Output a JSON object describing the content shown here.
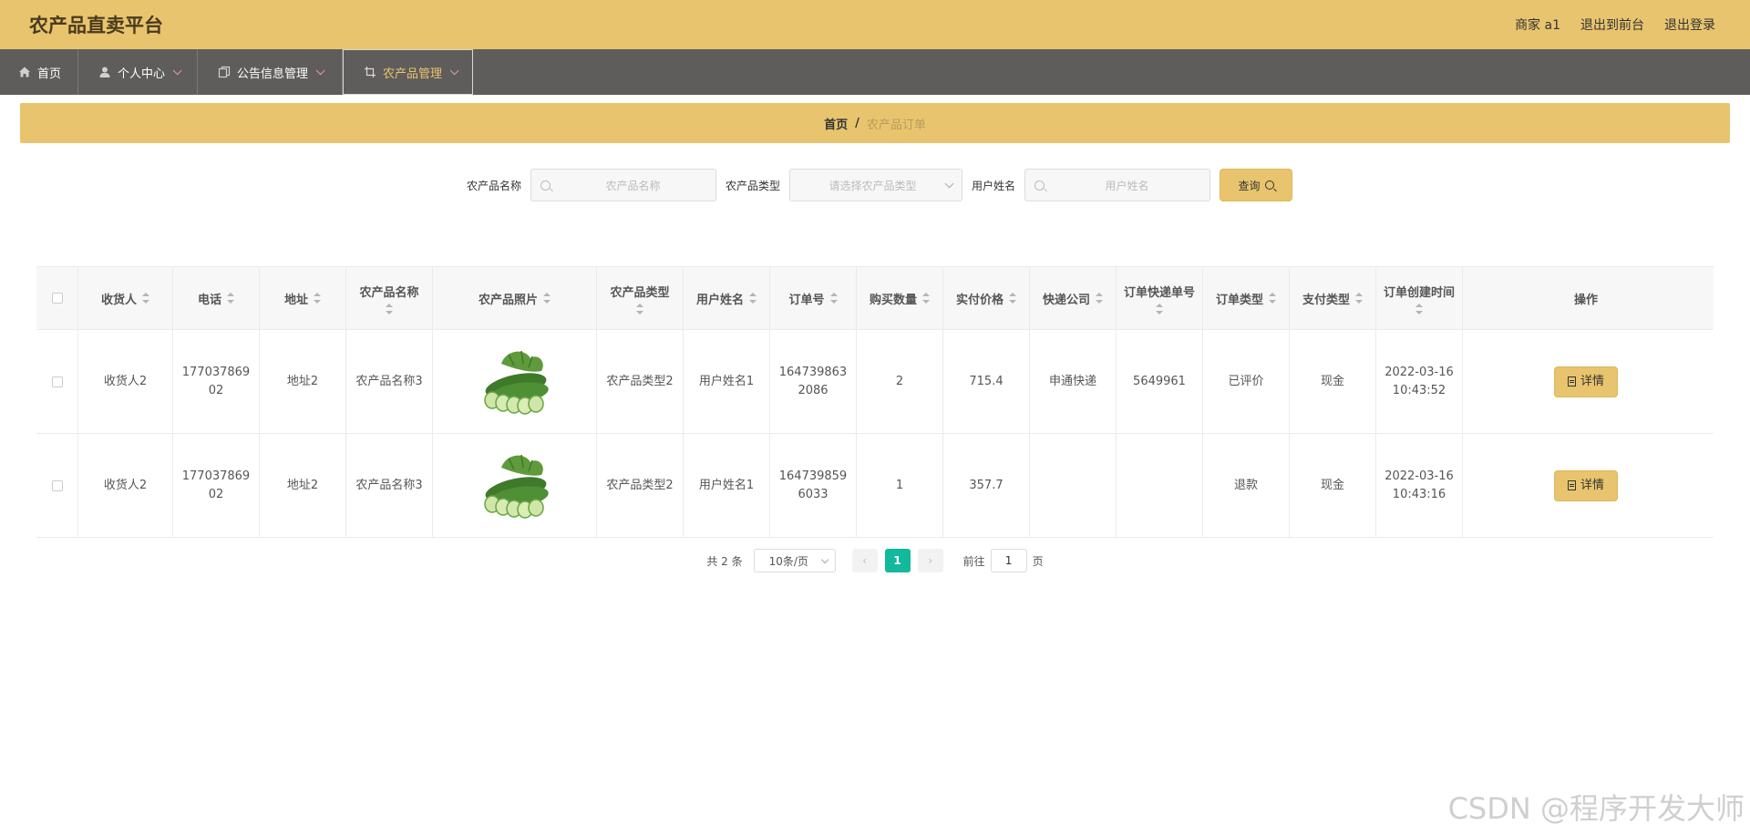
{
  "header": {
    "brand": "农产品直卖平台",
    "user": "商家 a1",
    "back_front": "退出到前台",
    "logout": "退出登录"
  },
  "nav": [
    {
      "label": "首页",
      "icon": "home-icon"
    },
    {
      "label": "个人中心",
      "icon": "user-icon"
    },
    {
      "label": "公告信息管理",
      "icon": "copy-icon"
    },
    {
      "label": "农产品管理",
      "icon": "crop-icon"
    }
  ],
  "breadcrumb": {
    "home": "首页",
    "sep": "/",
    "current": "农产品订单"
  },
  "filters": {
    "name_label": "农产品名称",
    "name_placeholder": "农产品名称",
    "type_label": "农产品类型",
    "type_placeholder": "请选择农产品类型",
    "user_label": "用户姓名",
    "user_placeholder": "用户姓名",
    "query_label": "查询"
  },
  "table": {
    "headers": [
      "收货人",
      "电话",
      "地址",
      "农产品名称",
      "农产品照片",
      "农产品类型",
      "用户姓名",
      "订单号",
      "购买数量",
      "实付价格",
      "快递公司",
      "订单快递单号",
      "订单类型",
      "支付类型",
      "订单创建时间",
      "操作"
    ],
    "rows": [
      {
        "receiver": "收货人2",
        "phone": "17703786902",
        "address": "地址2",
        "name": "农产品名称3",
        "type": "农产品类型2",
        "user": "用户姓名1",
        "order_no": "1647398632086",
        "qty": "2",
        "price": "715.4",
        "courier": "申通快递",
        "tracking": "5649961",
        "order_type": "已评价",
        "pay_type": "现金",
        "created_date": "2022-03-16",
        "created_time": "10:43:52",
        "action": "详情"
      },
      {
        "receiver": "收货人2",
        "phone": "17703786902",
        "address": "地址2",
        "name": "农产品名称3",
        "type": "农产品类型2",
        "user": "用户姓名1",
        "order_no": "1647398596033",
        "qty": "1",
        "price": "357.7",
        "courier": "",
        "tracking": "",
        "order_type": "退款",
        "pay_type": "现金",
        "created_date": "2022-03-16",
        "created_time": "10:43:16",
        "action": "详情"
      }
    ]
  },
  "pager": {
    "total": "共 2 条",
    "size": "10条/页",
    "page": "1",
    "goto": "前往",
    "goto_value": "1",
    "unit": "页"
  },
  "watermark": "CSDN @程序开发大师",
  "colors": {
    "brand": "#e8c46e",
    "nav": "#5f5d5b",
    "active_page": "#13b99d"
  }
}
